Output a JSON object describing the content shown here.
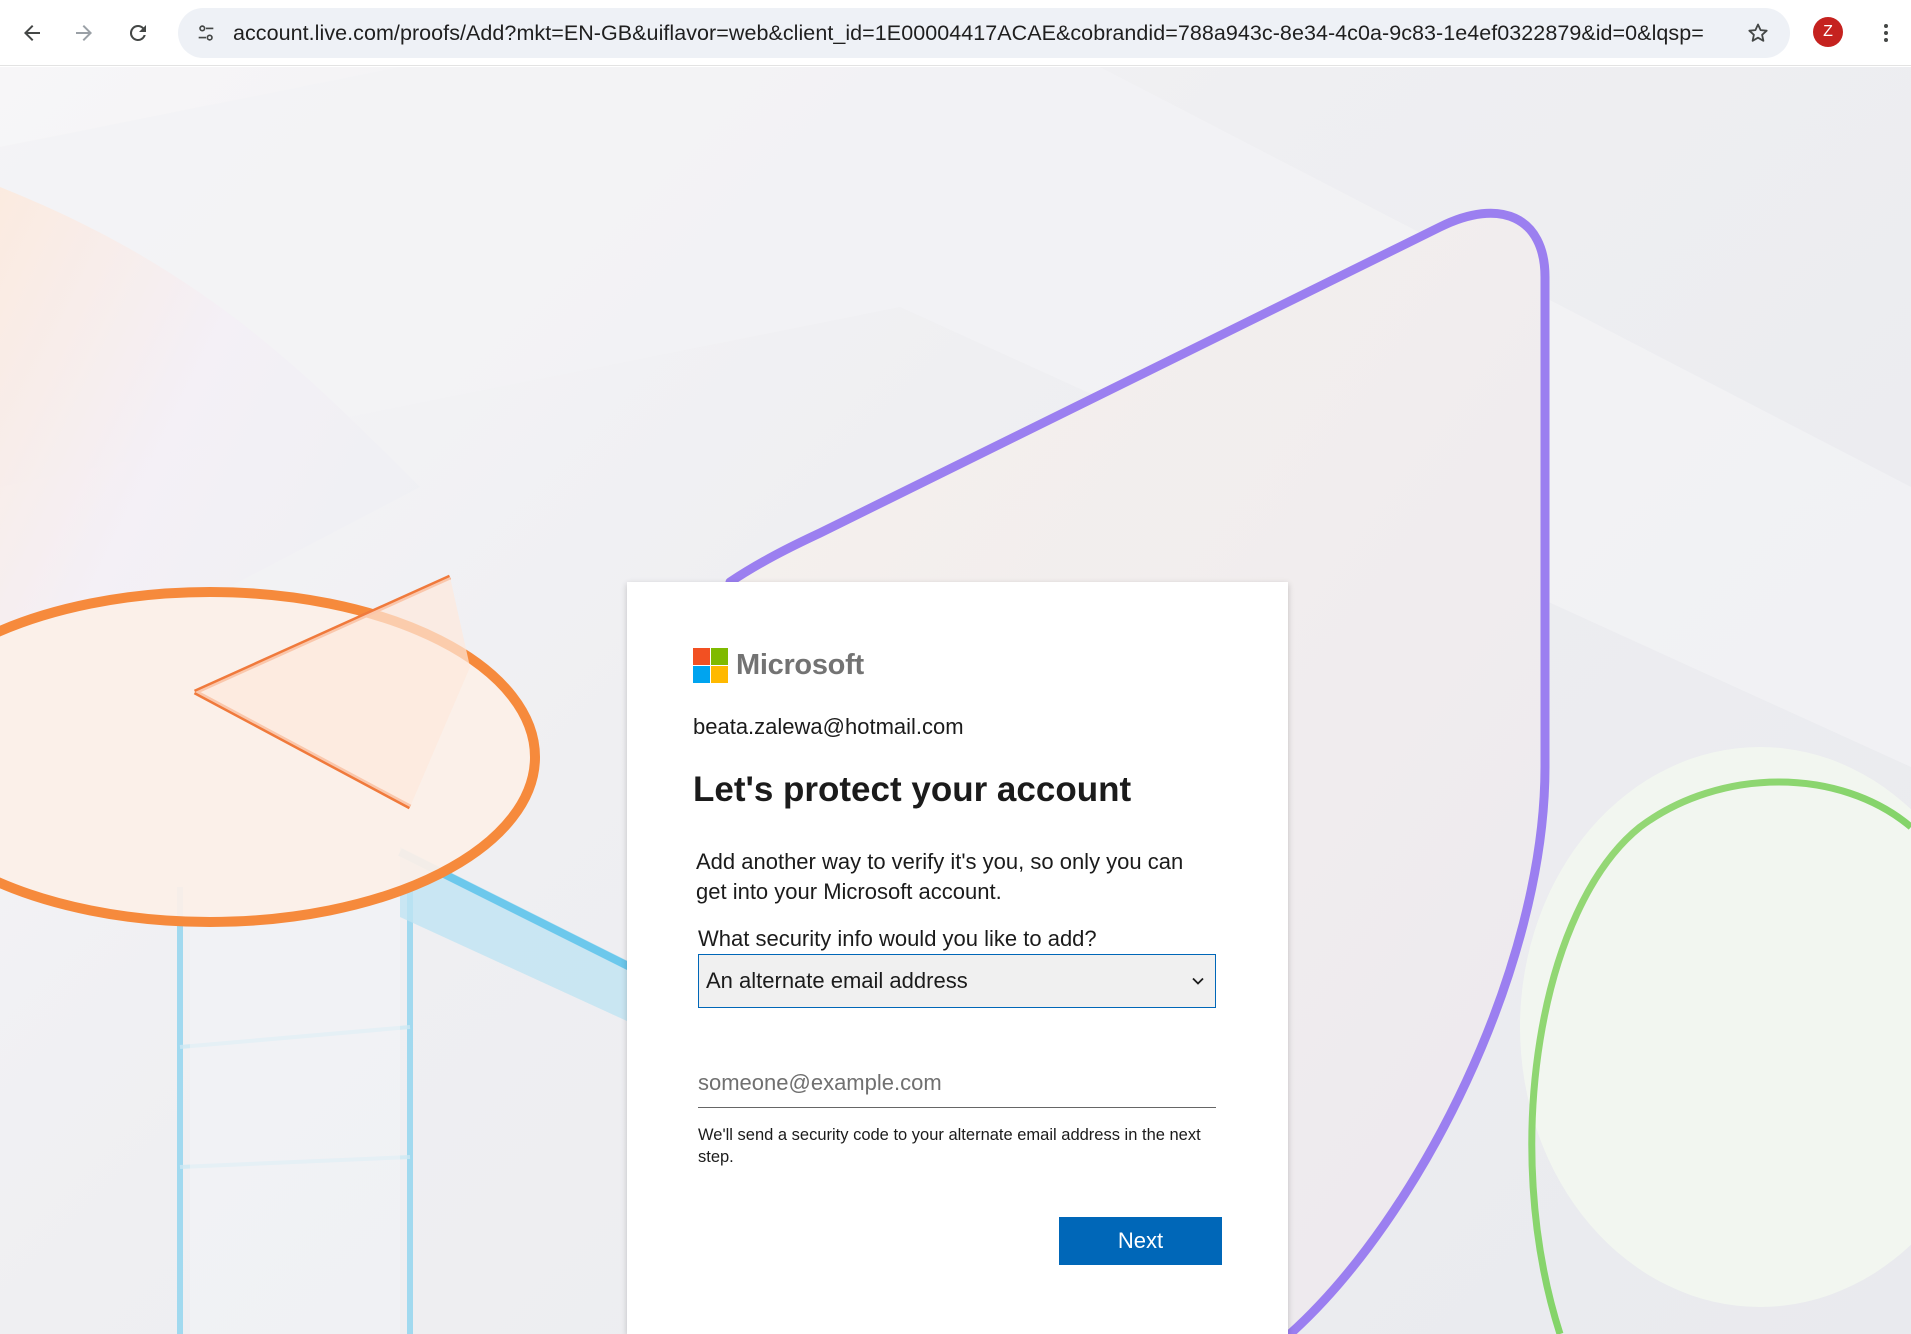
{
  "browser": {
    "url": "account.live.com/proofs/Add?mkt=EN-GB&uiflavor=web&client_id=1E00004417ACAE&cobrandid=788a943c-8e34-4c0a-9c83-1e4ef0322879&id=0&lqsp=ntp...",
    "profile_initial": "Z",
    "icons": {
      "back": "arrow-left",
      "forward": "arrow-right",
      "reload": "reload",
      "site_info": "tune",
      "bookmark": "star-outline",
      "menu": "three-dots-vertical"
    },
    "colors": {
      "profile_avatar": "#c5221f",
      "omnibox": "#eef1f6"
    }
  },
  "card": {
    "brand": "Microsoft",
    "brand_colors": [
      "#f25022",
      "#7fba00",
      "#00a4ef",
      "#ffb900"
    ],
    "identity": "beata.zalewa@hotmail.com",
    "title": "Let's protect your account",
    "description": "Add another way to verify it's you, so only you can get into your Microsoft account.",
    "select_label": "What security info would you like to add?",
    "select_value": "An alternate email address",
    "email_placeholder": "someone@example.com",
    "help_text": "We'll send a security code to your alternate email address in the next step.",
    "next_label": "Next",
    "accent_color": "#0067b8"
  }
}
